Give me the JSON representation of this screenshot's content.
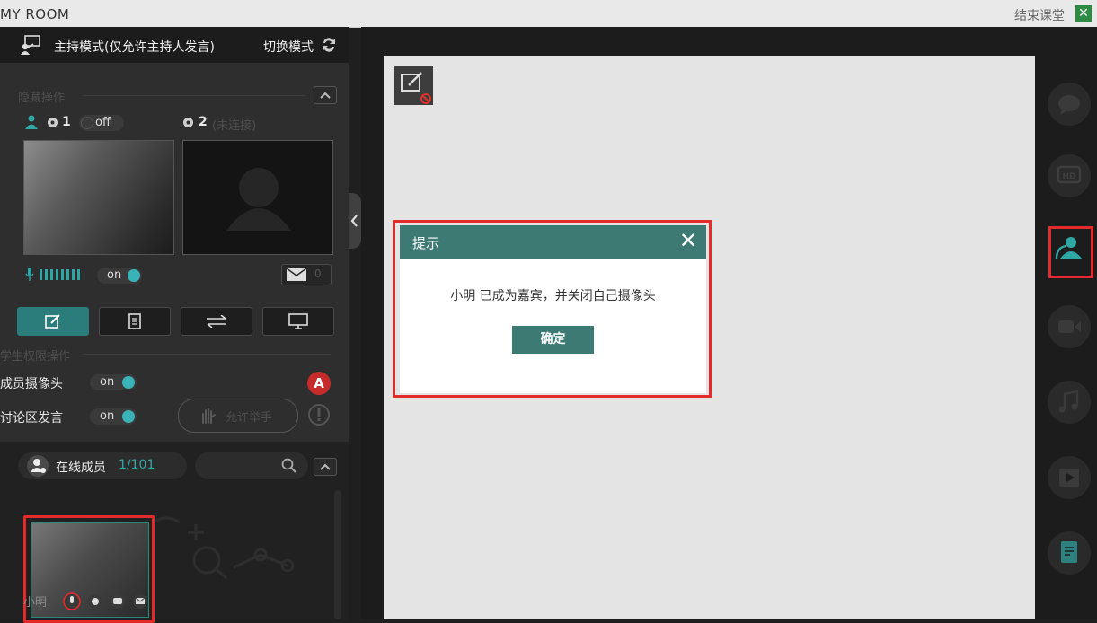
{
  "window": {
    "title": "MY ROOM",
    "end_class": "结束课堂",
    "close_glyph": "✕"
  },
  "host_bar": {
    "mode_label": "主持模式(仅允许主持人发言)",
    "switch_label": "切换模式"
  },
  "hidden_ops": {
    "title": "隐藏操作",
    "seat1": {
      "number": "1",
      "toggle": "off"
    },
    "seat2": {
      "number": "2",
      "status": "(未连接)"
    },
    "mic_toggle": "on",
    "message_count": "0"
  },
  "student_ops": {
    "title": "学生权限操作",
    "member_camera_label": "成员摄像头",
    "member_camera_toggle": "on",
    "discussion_label": "讨论区发言",
    "discussion_toggle": "on",
    "allow_raise_hand": "允许举手",
    "badge_letter": "A"
  },
  "members": {
    "label": "在线成员",
    "count": "1/101",
    "member_name": "小明"
  },
  "dialog": {
    "title": "提示",
    "message": "小明 已成为嘉宾，并关闭自己摄像头",
    "ok_label": "确定"
  },
  "colors": {
    "accent": "#3c7a73",
    "highlight": "#e32b2b",
    "toggle_knob": "#3ab3b8"
  },
  "sidebar_icons": [
    "chat-icon",
    "hd-icon",
    "guest-user-icon",
    "video-camera-icon",
    "music-icon",
    "play-icon",
    "notes-icon"
  ]
}
